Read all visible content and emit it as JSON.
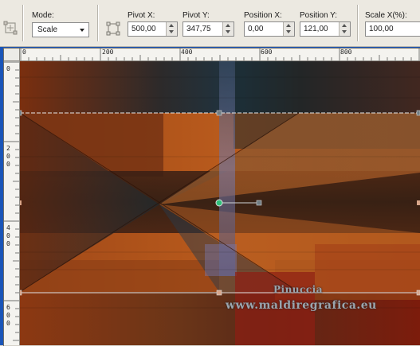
{
  "toolbar": {
    "mode": {
      "label": "Mode:",
      "value": "Scale"
    },
    "pivot_x": {
      "label": "Pivot X:",
      "value": "500,00"
    },
    "pivot_y": {
      "label": "Pivot Y:",
      "value": "347,75"
    },
    "position_x": {
      "label": "Position X:",
      "value": "0,00"
    },
    "position_y": {
      "label": "Position Y:",
      "value": "121,00"
    },
    "scale_x": {
      "label": "Scale X(%):",
      "value": "100,00"
    }
  },
  "ruler_h": {
    "ticks": [
      "0",
      "200",
      "400",
      "600",
      "800"
    ]
  },
  "ruler_v": {
    "ticks": [
      "0",
      "200",
      "400",
      "600"
    ]
  },
  "watermark": {
    "name": "Pinuccia",
    "url": "www.maldiregrafica.eu"
  },
  "colors": {
    "workspace": "#1a55b8",
    "handle": "#5a6a70",
    "pivot": "#2fbf7a"
  }
}
